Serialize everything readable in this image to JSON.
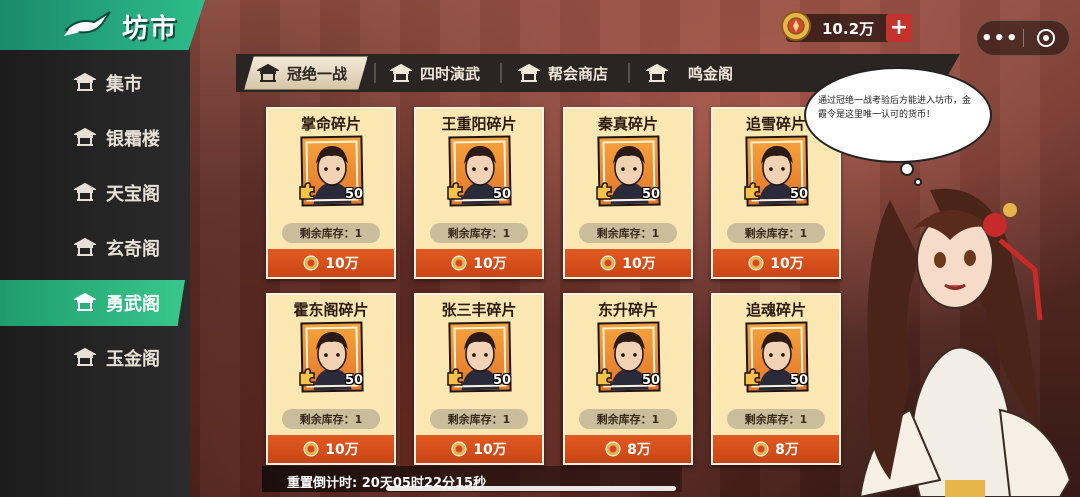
{
  "app": {
    "title": "坊市"
  },
  "currency": {
    "value": "10.2万",
    "add_label": "+"
  },
  "sidebar": {
    "items": [
      {
        "label": "集市",
        "active": false
      },
      {
        "label": "银霜楼",
        "active": false
      },
      {
        "label": "天宝阁",
        "active": false
      },
      {
        "label": "玄奇阁",
        "active": false
      },
      {
        "label": "勇武阁",
        "active": true
      },
      {
        "label": "玉金阁",
        "active": false
      }
    ]
  },
  "tabs": [
    {
      "label": "冠绝一战",
      "active": true
    },
    {
      "label": "四时演武",
      "active": false
    },
    {
      "label": "帮会商店",
      "active": false
    },
    {
      "label": "鸣金阁",
      "active": false
    }
  ],
  "cards": [
    {
      "name": "掌命碎片",
      "qty": "50",
      "stock": "剩余库存：1",
      "price": "10万",
      "colors": [
        "#f6a33c",
        "#e3762a"
      ]
    },
    {
      "name": "王重阳碎片",
      "qty": "50",
      "stock": "剩余库存：1",
      "price": "10万",
      "colors": [
        "#f6a33c",
        "#e3762a"
      ]
    },
    {
      "name": "秦真碎片",
      "qty": "50",
      "stock": "剩余库存：1",
      "price": "10万",
      "colors": [
        "#f6a33c",
        "#e3762a"
      ]
    },
    {
      "name": "追雪碎片",
      "qty": "50",
      "stock": "剩余库存：1",
      "price": "10万",
      "colors": [
        "#f6a33c",
        "#e3762a"
      ]
    },
    {
      "name": "霍东阁碎片",
      "qty": "50",
      "stock": "剩余库存：1",
      "price": "10万",
      "colors": [
        "#f6a33c",
        "#e3762a"
      ]
    },
    {
      "name": "张三丰碎片",
      "qty": "50",
      "stock": "剩余库存：1",
      "price": "10万",
      "colors": [
        "#f6a33c",
        "#e3762a"
      ]
    },
    {
      "name": "东升碎片",
      "qty": "50",
      "stock": "剩余库存：1",
      "price": "8万",
      "colors": [
        "#f6a33c",
        "#e3762a"
      ]
    },
    {
      "name": "追魂碎片",
      "qty": "50",
      "stock": "剩余库存：1",
      "price": "8万",
      "colors": [
        "#f6a33c",
        "#e3762a"
      ]
    }
  ],
  "npc": {
    "speech": "通过冠绝一战考验后方能进入坊市，金霞令是这里唯一认可的货币！"
  },
  "timer": {
    "text": "重置倒计时: 20天05时22分15秒"
  },
  "colors": {
    "accent": "#2ebd8b",
    "price_bar": "#e25a22",
    "card_bg": "#fbe7b2"
  }
}
